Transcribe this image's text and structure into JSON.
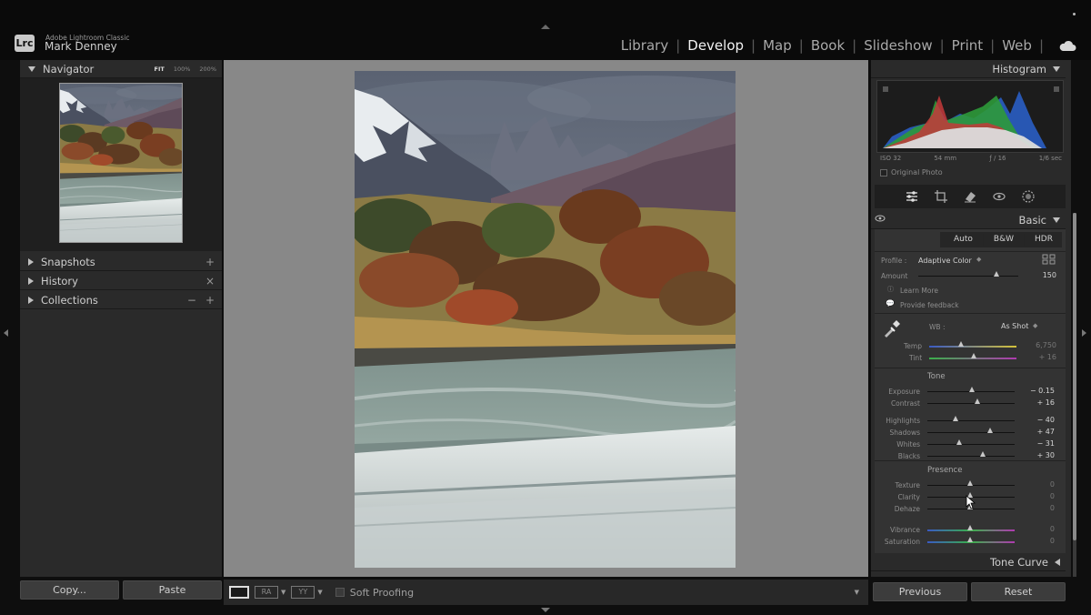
{
  "app": {
    "product": "Adobe Lightroom Classic",
    "logo": "Lrc",
    "user": "Mark Denney"
  },
  "modules": [
    "Library",
    "Develop",
    "Map",
    "Book",
    "Slideshow",
    "Print",
    "Web"
  ],
  "active_module": "Develop",
  "left_panel": {
    "navigator": {
      "label": "Navigator",
      "zoom": [
        "FIT",
        "100%",
        "200%"
      ],
      "active_zoom": "FIT"
    },
    "snapshots": {
      "label": "Snapshots",
      "action": "+"
    },
    "history": {
      "label": "History",
      "action": "×"
    },
    "collections": {
      "label": "Collections",
      "actions": [
        "−",
        "+"
      ]
    },
    "copy_button": "Copy...",
    "paste_button": "Paste"
  },
  "toolbar": {
    "soft_proofing": "Soft Proofing",
    "compare_labels": [
      "RA",
      "YY"
    ]
  },
  "right_panel": {
    "histogram": {
      "label": "Histogram",
      "iso": "ISO 32",
      "focal": "54 mm",
      "aperture": "ƒ / 16",
      "shutter": "1/6 sec",
      "original_photo": "Original Photo"
    },
    "basic": {
      "label": "Basic",
      "treatments": [
        "Auto",
        "B&W",
        "HDR"
      ],
      "profile_label": "Profile :",
      "profile_value": "Adaptive Color",
      "amount_label": "Amount",
      "amount_value": "150",
      "learn_more": "Learn More",
      "feedback": "Provide feedback",
      "wb_label": "WB :",
      "wb_value": "As Shot",
      "temp": {
        "label": "Temp",
        "value": "6,750"
      },
      "tint": {
        "label": "Tint",
        "value": "+ 16"
      },
      "tone_title": "Tone",
      "tone": [
        {
          "label": "Exposure",
          "value": "− 0.15"
        },
        {
          "label": "Contrast",
          "value": "+ 16"
        },
        {
          "label": "Highlights",
          "value": "− 40"
        },
        {
          "label": "Shadows",
          "value": "+ 47"
        },
        {
          "label": "Whites",
          "value": "− 31"
        },
        {
          "label": "Blacks",
          "value": "+ 30"
        }
      ],
      "presence_title": "Presence",
      "presence": [
        {
          "label": "Texture",
          "value": "0"
        },
        {
          "label": "Clarity",
          "value": "0"
        },
        {
          "label": "Dehaze",
          "value": "0"
        },
        {
          "label": "Vibrance",
          "value": "0"
        },
        {
          "label": "Saturation",
          "value": "0"
        }
      ]
    },
    "tone_curve": {
      "label": "Tone Curve"
    },
    "previous_button": "Previous",
    "reset_button": "Reset"
  }
}
